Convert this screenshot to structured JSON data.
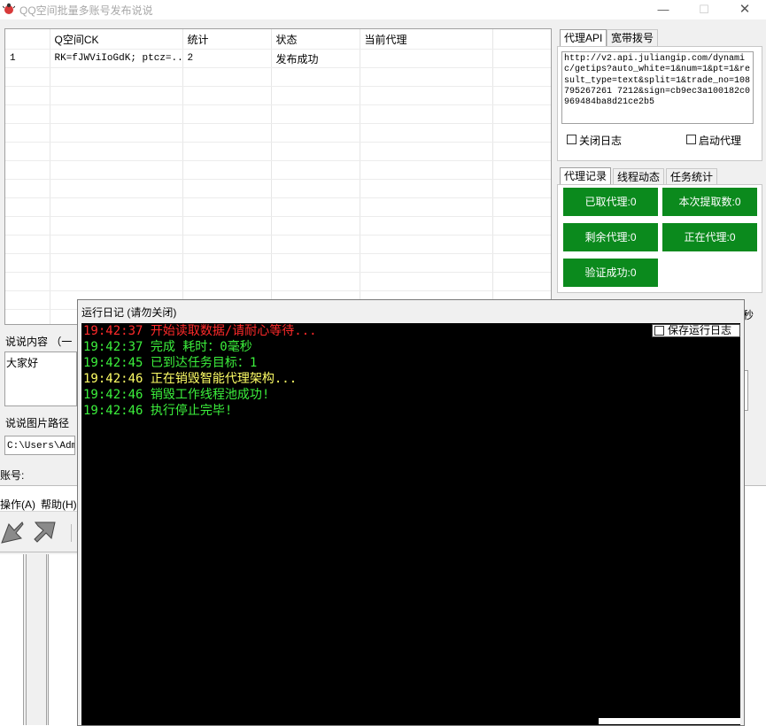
{
  "window": {
    "title": "QQ空间批量多账号发布说说",
    "min_glyph": "—",
    "max_glyph": "☐",
    "close_glyph": "✕"
  },
  "table": {
    "columns": [
      "",
      "Q空间CK",
      "统计",
      "状态",
      "当前代理"
    ],
    "rows": [
      [
        "1",
        "RK=fJWViIoGdK; ptcz=...",
        "2",
        "发布成功",
        ""
      ]
    ]
  },
  "proxy_panel": {
    "tabs": [
      "代理API",
      "宽带拨号"
    ],
    "api_url": "http://v2.api.juliangip.com/dynamic/getips?auto_white=1&num=1&pt=1&result_type=text&split=1&trade_no=108795267261 7212&sign=cb9ec3a100182c0969484ba8d21ce2b5",
    "close_log_label": "关闭日志",
    "start_proxy_label": "启动代理"
  },
  "stats_panel": {
    "tabs": [
      "代理记录",
      "线程动态",
      "任务统计"
    ],
    "buttons": [
      "已取代理:0",
      "本次提取数:0",
      "剩余代理:0",
      "正在代理:0",
      "验证成功:0"
    ],
    "accent": "#0b8a1d"
  },
  "form": {
    "content_label": "说说内容  （一",
    "content_value": "大家好",
    "image_path_label": "说说图片路径",
    "image_path_value": "C:\\Users\\Admi",
    "account_label": "账号:",
    "seconds_suffix": "秒"
  },
  "bg_window": {
    "menu": [
      "操作(A)",
      "帮助(H)"
    ]
  },
  "log": {
    "title": "运行日记 (请勿关闭)",
    "save_label": "保存运行日志",
    "lines": [
      {
        "time": "19:42:37",
        "text": "开始读取数据/请耐心等待...",
        "color": "#ff2a2a"
      },
      {
        "time": "19:42:37",
        "text": "完成 耗时：0毫秒",
        "color": "#3cf03c"
      },
      {
        "time": "19:42:45",
        "text": "已到达任务目标：1",
        "color": "#3cf03c"
      },
      {
        "time": "19:42:46",
        "text": "正在销毁智能代理架构...",
        "color": "#ffff66"
      },
      {
        "time": "19:42:46",
        "text": "销毁工作线程池成功!",
        "color": "#3cf03c"
      },
      {
        "time": "19:42:46",
        "text": "执行停止完毕!",
        "color": "#3cf03c"
      }
    ]
  }
}
